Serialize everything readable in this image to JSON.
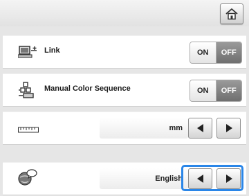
{
  "header": {
    "home_icon": "home-icon"
  },
  "rows": [
    {
      "id": "link",
      "icon": "computer-link-icon",
      "label": "Link",
      "control": "toggle",
      "on_label": "ON",
      "off_label": "OFF",
      "selected": "OFF"
    },
    {
      "id": "manual-color-sequence",
      "icon": "color-sequence-icon",
      "label": "Manual Color Sequence",
      "control": "toggle",
      "on_label": "ON",
      "off_label": "OFF",
      "selected": "OFF"
    },
    {
      "id": "unit",
      "icon": "ruler-icon",
      "value": "mm",
      "control": "arrows"
    },
    {
      "id": "language",
      "icon": "globe-speech-icon",
      "value": "English",
      "control": "arrows"
    }
  ],
  "colors": {
    "highlight": "#2a86e8",
    "off_active": "#7f7f7f"
  }
}
